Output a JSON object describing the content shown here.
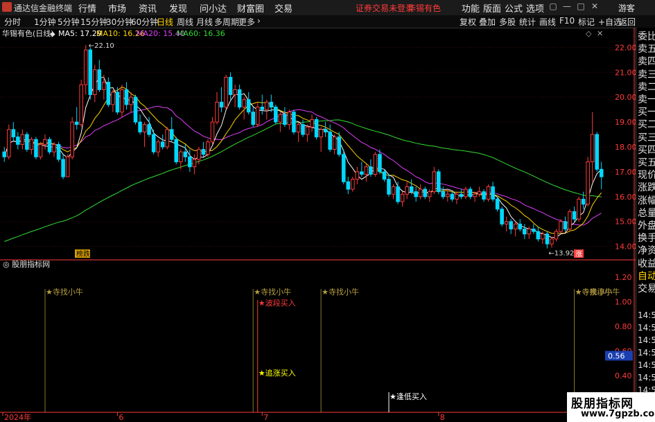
{
  "app": {
    "name": "通达信金融终端"
  },
  "menu": [
    "行情",
    "市场",
    "资讯",
    "发现",
    "问小达",
    "财富圈",
    "交易"
  ],
  "login_notice": "证券交易未登录",
  "login_stock": "华锡有色",
  "top_right": [
    "功能",
    "版面",
    "公式",
    "选项"
  ],
  "guest": "游客",
  "timeframes": [
    "分时",
    "1分钟",
    "5分钟",
    "15分钟",
    "30分钟",
    "60分钟",
    "日线",
    "周线",
    "月线",
    "多周期",
    "更多"
  ],
  "active_timeframe": "日线",
  "right_tools": [
    "复权",
    "叠加",
    "多股",
    "统计",
    "画线",
    "F10",
    "标记",
    "+自选",
    "返回"
  ],
  "main_header": {
    "title": "华锡有色(日线)",
    "ma5": "MA5: 17.29",
    "ma10": "MA10: 16.26",
    "ma20": "MA20: 15.40",
    "ma60": "MA60: 16.36"
  },
  "colors": {
    "up": "#ff3b3b",
    "down": "#00d8ff",
    "ma5": "#ffffff",
    "ma10": "#ffd400",
    "ma20": "#e040fb",
    "ma60": "#33dd33",
    "bg": "#000000",
    "axis": "#ff3b3b",
    "grid": "#4a1010"
  },
  "side_panel": [
    "委比",
    "卖五",
    "卖四",
    "卖三",
    "卖二",
    "卖一",
    "买一",
    "买二",
    "买三",
    "买四",
    "买五",
    "现价",
    "涨跌",
    "涨幅",
    "总量",
    "外盘",
    "换手",
    "净资",
    "收益",
    "自动",
    "交易"
  ],
  "side_times": [
    "14:5",
    "14:5",
    "14:5",
    "14:5",
    "14:5",
    "14:5",
    "14:5",
    "14:5",
    "14:5"
  ],
  "indicator": {
    "title": "股朋指标网",
    "current_value": "0.56",
    "labels": [
      {
        "text": "寺找小牛",
        "x_idx": 9,
        "row": "top",
        "color": "gold"
      },
      {
        "text": "寺找小牛",
        "x_idx": 55,
        "row": "top",
        "color": "gold"
      },
      {
        "text": "寺找小牛",
        "x_idx": 70,
        "row": "top",
        "color": "gold"
      },
      {
        "text": "寺找小牛",
        "x_idx": 126,
        "row": "top",
        "color": "gold"
      },
      {
        "text": "寺亲淳小牛",
        "x_idx": 126,
        "row": "top2",
        "color": "gold"
      },
      {
        "text": "波段买入",
        "x_idx": 56,
        "row": "mid",
        "color": "red"
      },
      {
        "text": "波段买入",
        "x_idx": 160,
        "row": "mid",
        "color": "red"
      },
      {
        "text": "追涨买入",
        "x_idx": 56,
        "row": "low",
        "color": "yellow"
      },
      {
        "text": "逢低买入",
        "x_idx": 85,
        "row": "bot",
        "color": "white"
      },
      {
        "text": "逢低买入",
        "x_idx": 148,
        "row": "bot",
        "color": "white"
      }
    ]
  },
  "badges": {
    "left": "榜跌",
    "right": "涨"
  },
  "watermark": {
    "line1": "股朋指标网",
    "line2": "www.7gpzb.com"
  },
  "chart_data": {
    "type": "candlestick",
    "title": "华锡有色(日线)",
    "ylim": [
      13.6,
      22.4
    ],
    "yticks": [
      14.0,
      15.0,
      16.0,
      17.0,
      18.0,
      19.0,
      20.0,
      21.0,
      22.0
    ],
    "xlabels": [
      {
        "text": "2024年",
        "idx": 0
      },
      {
        "text": "6",
        "idx": 25
      },
      {
        "text": "7",
        "idx": 57
      },
      {
        "text": "8",
        "idx": 96
      },
      {
        "text": "9",
        "idx": 131
      }
    ],
    "max_label": "22.10",
    "min_label": "13.92",
    "indicator_ylim": [
      0.1,
      1.3
    ],
    "indicator_yticks": [
      0.2,
      0.4,
      0.6,
      0.8,
      1.0,
      1.2
    ],
    "candles": [
      [
        17.8,
        18.0,
        17.4,
        17.6
      ],
      [
        17.6,
        18.9,
        17.5,
        18.7
      ],
      [
        18.7,
        19.0,
        18.2,
        18.4
      ],
      [
        18.4,
        18.6,
        17.9,
        18.1
      ],
      [
        18.1,
        18.7,
        17.9,
        18.5
      ],
      [
        18.5,
        18.6,
        17.8,
        17.9
      ],
      [
        17.9,
        18.4,
        17.7,
        18.3
      ],
      [
        18.3,
        18.4,
        17.5,
        17.6
      ],
      [
        17.6,
        18.2,
        17.5,
        18.1
      ],
      [
        18.1,
        18.5,
        17.9,
        18.3
      ],
      [
        18.3,
        18.4,
        17.7,
        17.8
      ],
      [
        17.8,
        18.2,
        17.6,
        18.1
      ],
      [
        18.1,
        18.2,
        17.4,
        17.5
      ],
      [
        17.5,
        17.7,
        16.7,
        16.8
      ],
      [
        16.8,
        17.7,
        16.8,
        17.6
      ],
      [
        17.6,
        19.2,
        17.5,
        19.0
      ],
      [
        19.0,
        19.6,
        18.7,
        18.9
      ],
      [
        18.9,
        20.7,
        18.8,
        20.5
      ],
      [
        20.5,
        22.1,
        20.1,
        21.9
      ],
      [
        21.9,
        22.0,
        19.9,
        20.1
      ],
      [
        20.1,
        21.3,
        19.8,
        21.1
      ],
      [
        21.1,
        21.5,
        20.2,
        20.3
      ],
      [
        20.3,
        20.9,
        19.9,
        20.6
      ],
      [
        20.6,
        20.8,
        19.6,
        19.7
      ],
      [
        19.7,
        20.3,
        19.4,
        20.2
      ],
      [
        20.2,
        20.4,
        19.3,
        19.4
      ],
      [
        19.4,
        20.5,
        19.2,
        20.3
      ],
      [
        20.3,
        20.6,
        19.5,
        19.7
      ],
      [
        19.7,
        20.2,
        19.4,
        20.0
      ],
      [
        20.0,
        20.1,
        18.9,
        19.0
      ],
      [
        19.0,
        19.3,
        18.5,
        18.6
      ],
      [
        18.6,
        19.0,
        18.0,
        18.9
      ],
      [
        18.9,
        19.2,
        18.4,
        18.5
      ],
      [
        18.5,
        18.7,
        17.7,
        17.8
      ],
      [
        17.8,
        18.3,
        17.6,
        18.2
      ],
      [
        18.2,
        18.5,
        17.9,
        18.0
      ],
      [
        18.0,
        18.8,
        17.9,
        18.7
      ],
      [
        18.7,
        19.2,
        18.2,
        18.3
      ],
      [
        18.3,
        18.4,
        17.3,
        17.4
      ],
      [
        17.4,
        17.9,
        17.1,
        17.8
      ],
      [
        17.8,
        18.1,
        17.4,
        17.6
      ],
      [
        17.6,
        17.9,
        17.0,
        17.2
      ],
      [
        17.2,
        17.7,
        16.9,
        17.5
      ],
      [
        17.5,
        18.0,
        17.3,
        17.9
      ],
      [
        17.9,
        18.2,
        17.6,
        17.7
      ],
      [
        17.7,
        18.3,
        17.6,
        18.2
      ],
      [
        18.2,
        19.2,
        18.1,
        19.0
      ],
      [
        19.0,
        20.2,
        18.9,
        19.8
      ],
      [
        19.8,
        20.4,
        19.4,
        19.6
      ],
      [
        19.6,
        20.9,
        19.5,
        20.8
      ],
      [
        20.8,
        21.0,
        19.9,
        20.1
      ],
      [
        20.1,
        20.5,
        19.6,
        20.3
      ],
      [
        20.3,
        20.5,
        19.5,
        19.6
      ],
      [
        19.6,
        20.0,
        19.1,
        19.9
      ],
      [
        19.9,
        20.2,
        19.3,
        19.4
      ],
      [
        19.4,
        19.6,
        18.8,
        18.9
      ],
      [
        18.9,
        19.8,
        18.8,
        19.6
      ],
      [
        19.6,
        20.1,
        19.3,
        19.5
      ],
      [
        19.5,
        19.9,
        19.1,
        19.8
      ],
      [
        19.8,
        20.1,
        19.4,
        19.6
      ],
      [
        19.6,
        19.7,
        18.9,
        19.0
      ],
      [
        19.0,
        19.4,
        18.6,
        19.3
      ],
      [
        19.3,
        19.6,
        18.8,
        18.9
      ],
      [
        18.9,
        19.5,
        18.7,
        19.4
      ],
      [
        19.4,
        19.5,
        18.5,
        18.6
      ],
      [
        18.6,
        19.0,
        18.2,
        18.9
      ],
      [
        18.9,
        19.1,
        18.4,
        18.5
      ],
      [
        18.5,
        18.9,
        18.2,
        18.8
      ],
      [
        18.8,
        19.3,
        18.6,
        19.1
      ],
      [
        19.1,
        19.2,
        18.3,
        18.4
      ],
      [
        18.4,
        18.8,
        17.8,
        18.7
      ],
      [
        18.7,
        19.0,
        18.4,
        18.6
      ],
      [
        18.6,
        18.9,
        17.8,
        17.9
      ],
      [
        17.9,
        18.5,
        17.7,
        18.4
      ],
      [
        18.4,
        18.6,
        17.6,
        17.7
      ],
      [
        17.7,
        17.9,
        16.5,
        16.6
      ],
      [
        16.6,
        16.8,
        16.1,
        16.3
      ],
      [
        16.3,
        16.8,
        16.2,
        16.7
      ],
      [
        16.7,
        17.2,
        16.5,
        17.0
      ],
      [
        17.0,
        17.4,
        16.8,
        16.9
      ],
      [
        16.9,
        17.3,
        16.6,
        17.2
      ],
      [
        17.2,
        17.5,
        16.8,
        16.9
      ],
      [
        16.9,
        17.8,
        16.8,
        17.7
      ],
      [
        17.7,
        17.9,
        16.9,
        17.0
      ],
      [
        17.0,
        17.1,
        16.6,
        16.7
      ],
      [
        16.7,
        16.9,
        16.0,
        16.1
      ],
      [
        16.1,
        16.5,
        15.9,
        16.4
      ],
      [
        16.4,
        16.6,
        15.7,
        15.8
      ],
      [
        15.8,
        16.2,
        15.6,
        16.1
      ],
      [
        16.1,
        16.6,
        15.9,
        16.4
      ],
      [
        16.4,
        16.7,
        16.1,
        16.2
      ],
      [
        16.2,
        16.4,
        15.8,
        16.0
      ],
      [
        16.0,
        16.5,
        15.9,
        16.3
      ],
      [
        16.3,
        16.4,
        15.9,
        16.0
      ],
      [
        16.0,
        16.3,
        15.8,
        16.2
      ],
      [
        16.2,
        17.2,
        16.1,
        17.0
      ],
      [
        17.0,
        17.1,
        16.1,
        16.2
      ],
      [
        16.2,
        16.4,
        15.9,
        16.0
      ],
      [
        16.0,
        16.3,
        15.8,
        16.1
      ],
      [
        16.1,
        16.2,
        15.8,
        15.9
      ],
      [
        15.9,
        16.2,
        15.7,
        16.1
      ],
      [
        16.1,
        16.3,
        15.9,
        16.0
      ],
      [
        16.0,
        16.4,
        15.9,
        16.3
      ],
      [
        16.3,
        16.4,
        15.9,
        16.0
      ],
      [
        16.0,
        16.2,
        15.8,
        16.1
      ],
      [
        16.1,
        16.4,
        16.0,
        16.2
      ],
      [
        16.2,
        16.3,
        15.8,
        15.9
      ],
      [
        15.9,
        16.5,
        15.8,
        16.4
      ],
      [
        16.4,
        16.6,
        15.8,
        15.9
      ],
      [
        15.9,
        16.0,
        15.4,
        15.5
      ],
      [
        15.5,
        15.6,
        14.8,
        14.9
      ],
      [
        14.9,
        15.2,
        14.6,
        15.0
      ],
      [
        15.0,
        15.1,
        14.5,
        14.7
      ],
      [
        14.7,
        15.0,
        14.4,
        14.9
      ],
      [
        14.9,
        15.1,
        14.6,
        14.7
      ],
      [
        14.7,
        14.9,
        14.3,
        14.5
      ],
      [
        14.5,
        14.8,
        14.3,
        14.7
      ],
      [
        14.7,
        14.9,
        14.5,
        14.6
      ],
      [
        14.6,
        14.8,
        14.2,
        14.3
      ],
      [
        14.3,
        14.6,
        14.1,
        14.5
      ],
      [
        14.5,
        14.6,
        13.92,
        14.1
      ],
      [
        14.1,
        14.4,
        13.95,
        14.3
      ],
      [
        14.3,
        14.7,
        14.2,
        14.6
      ],
      [
        14.6,
        15.1,
        14.5,
        15.0
      ],
      [
        15.0,
        15.2,
        14.6,
        14.7
      ],
      [
        14.7,
        15.5,
        14.6,
        15.4
      ],
      [
        15.4,
        15.6,
        15.0,
        15.1
      ],
      [
        15.1,
        16.0,
        15.0,
        15.9
      ],
      [
        15.9,
        16.2,
        15.5,
        15.7
      ],
      [
        15.7,
        17.6,
        15.6,
        17.4
      ],
      [
        17.4,
        19.4,
        16.6,
        18.5
      ],
      [
        18.5,
        18.6,
        17.0,
        17.1
      ],
      [
        17.1,
        17.4,
        16.3,
        16.8
      ]
    ],
    "ma5": [],
    "ma10": [],
    "ma20": [],
    "ma60": []
  }
}
